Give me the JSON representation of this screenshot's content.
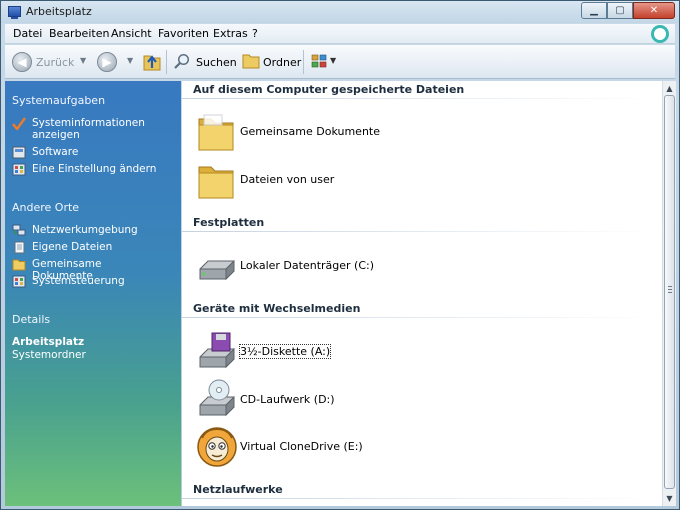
{
  "window": {
    "title": "Arbeitsplatz"
  },
  "menu": {
    "items": [
      "Datei",
      "Bearbeiten",
      "Ansicht",
      "Favoriten",
      "Extras",
      "?"
    ]
  },
  "toolbar": {
    "back_label": "Zurück",
    "search_label": "Suchen",
    "folders_label": "Ordner"
  },
  "taskpane": {
    "system_tasks": {
      "heading": "Systemaufgaben",
      "items": [
        {
          "label": "Systeminformationen anzeigen",
          "icon": "checkmark-icon"
        },
        {
          "label": "Software",
          "icon": "software-icon"
        },
        {
          "label": "Eine Einstellung ändern",
          "icon": "control-panel-icon"
        }
      ]
    },
    "other_places": {
      "heading": "Andere Orte",
      "items": [
        {
          "label": "Netzwerkumgebung",
          "icon": "network-icon"
        },
        {
          "label": "Eigene Dateien",
          "icon": "documents-icon"
        },
        {
          "label": "Gemeinsame Dokumente",
          "icon": "folder-icon"
        },
        {
          "label": "Systemsteuerung",
          "icon": "control-panel-icon"
        }
      ]
    },
    "details": {
      "heading": "Details",
      "name": "Arbeitsplatz",
      "type": "Systemordner"
    }
  },
  "content": {
    "groups": [
      {
        "title": "Auf diesem Computer gespeicherte Dateien",
        "items": [
          {
            "label": "Gemeinsame Dokumente",
            "icon": "folder-icon"
          },
          {
            "label": "Dateien von user",
            "icon": "folder-icon"
          }
        ]
      },
      {
        "title": "Festplatten",
        "items": [
          {
            "label": "Lokaler Datenträger (C:)",
            "icon": "hard-drive-icon"
          }
        ]
      },
      {
        "title": "Geräte mit Wechselmedien",
        "items": [
          {
            "label": "3½-Diskette (A:)",
            "icon": "floppy-drive-icon"
          },
          {
            "label": "CD-Laufwerk (D:)",
            "icon": "cd-drive-icon"
          },
          {
            "label": "Virtual CloneDrive (E:)",
            "icon": "clonedrive-sheep-icon"
          }
        ]
      },
      {
        "title": "Netzlaufwerke",
        "items": []
      }
    ]
  },
  "colors": {
    "taskpane_top": "#3879c0",
    "taskpane_bottom": "#6cc07a",
    "close_button": "#c4412c"
  }
}
